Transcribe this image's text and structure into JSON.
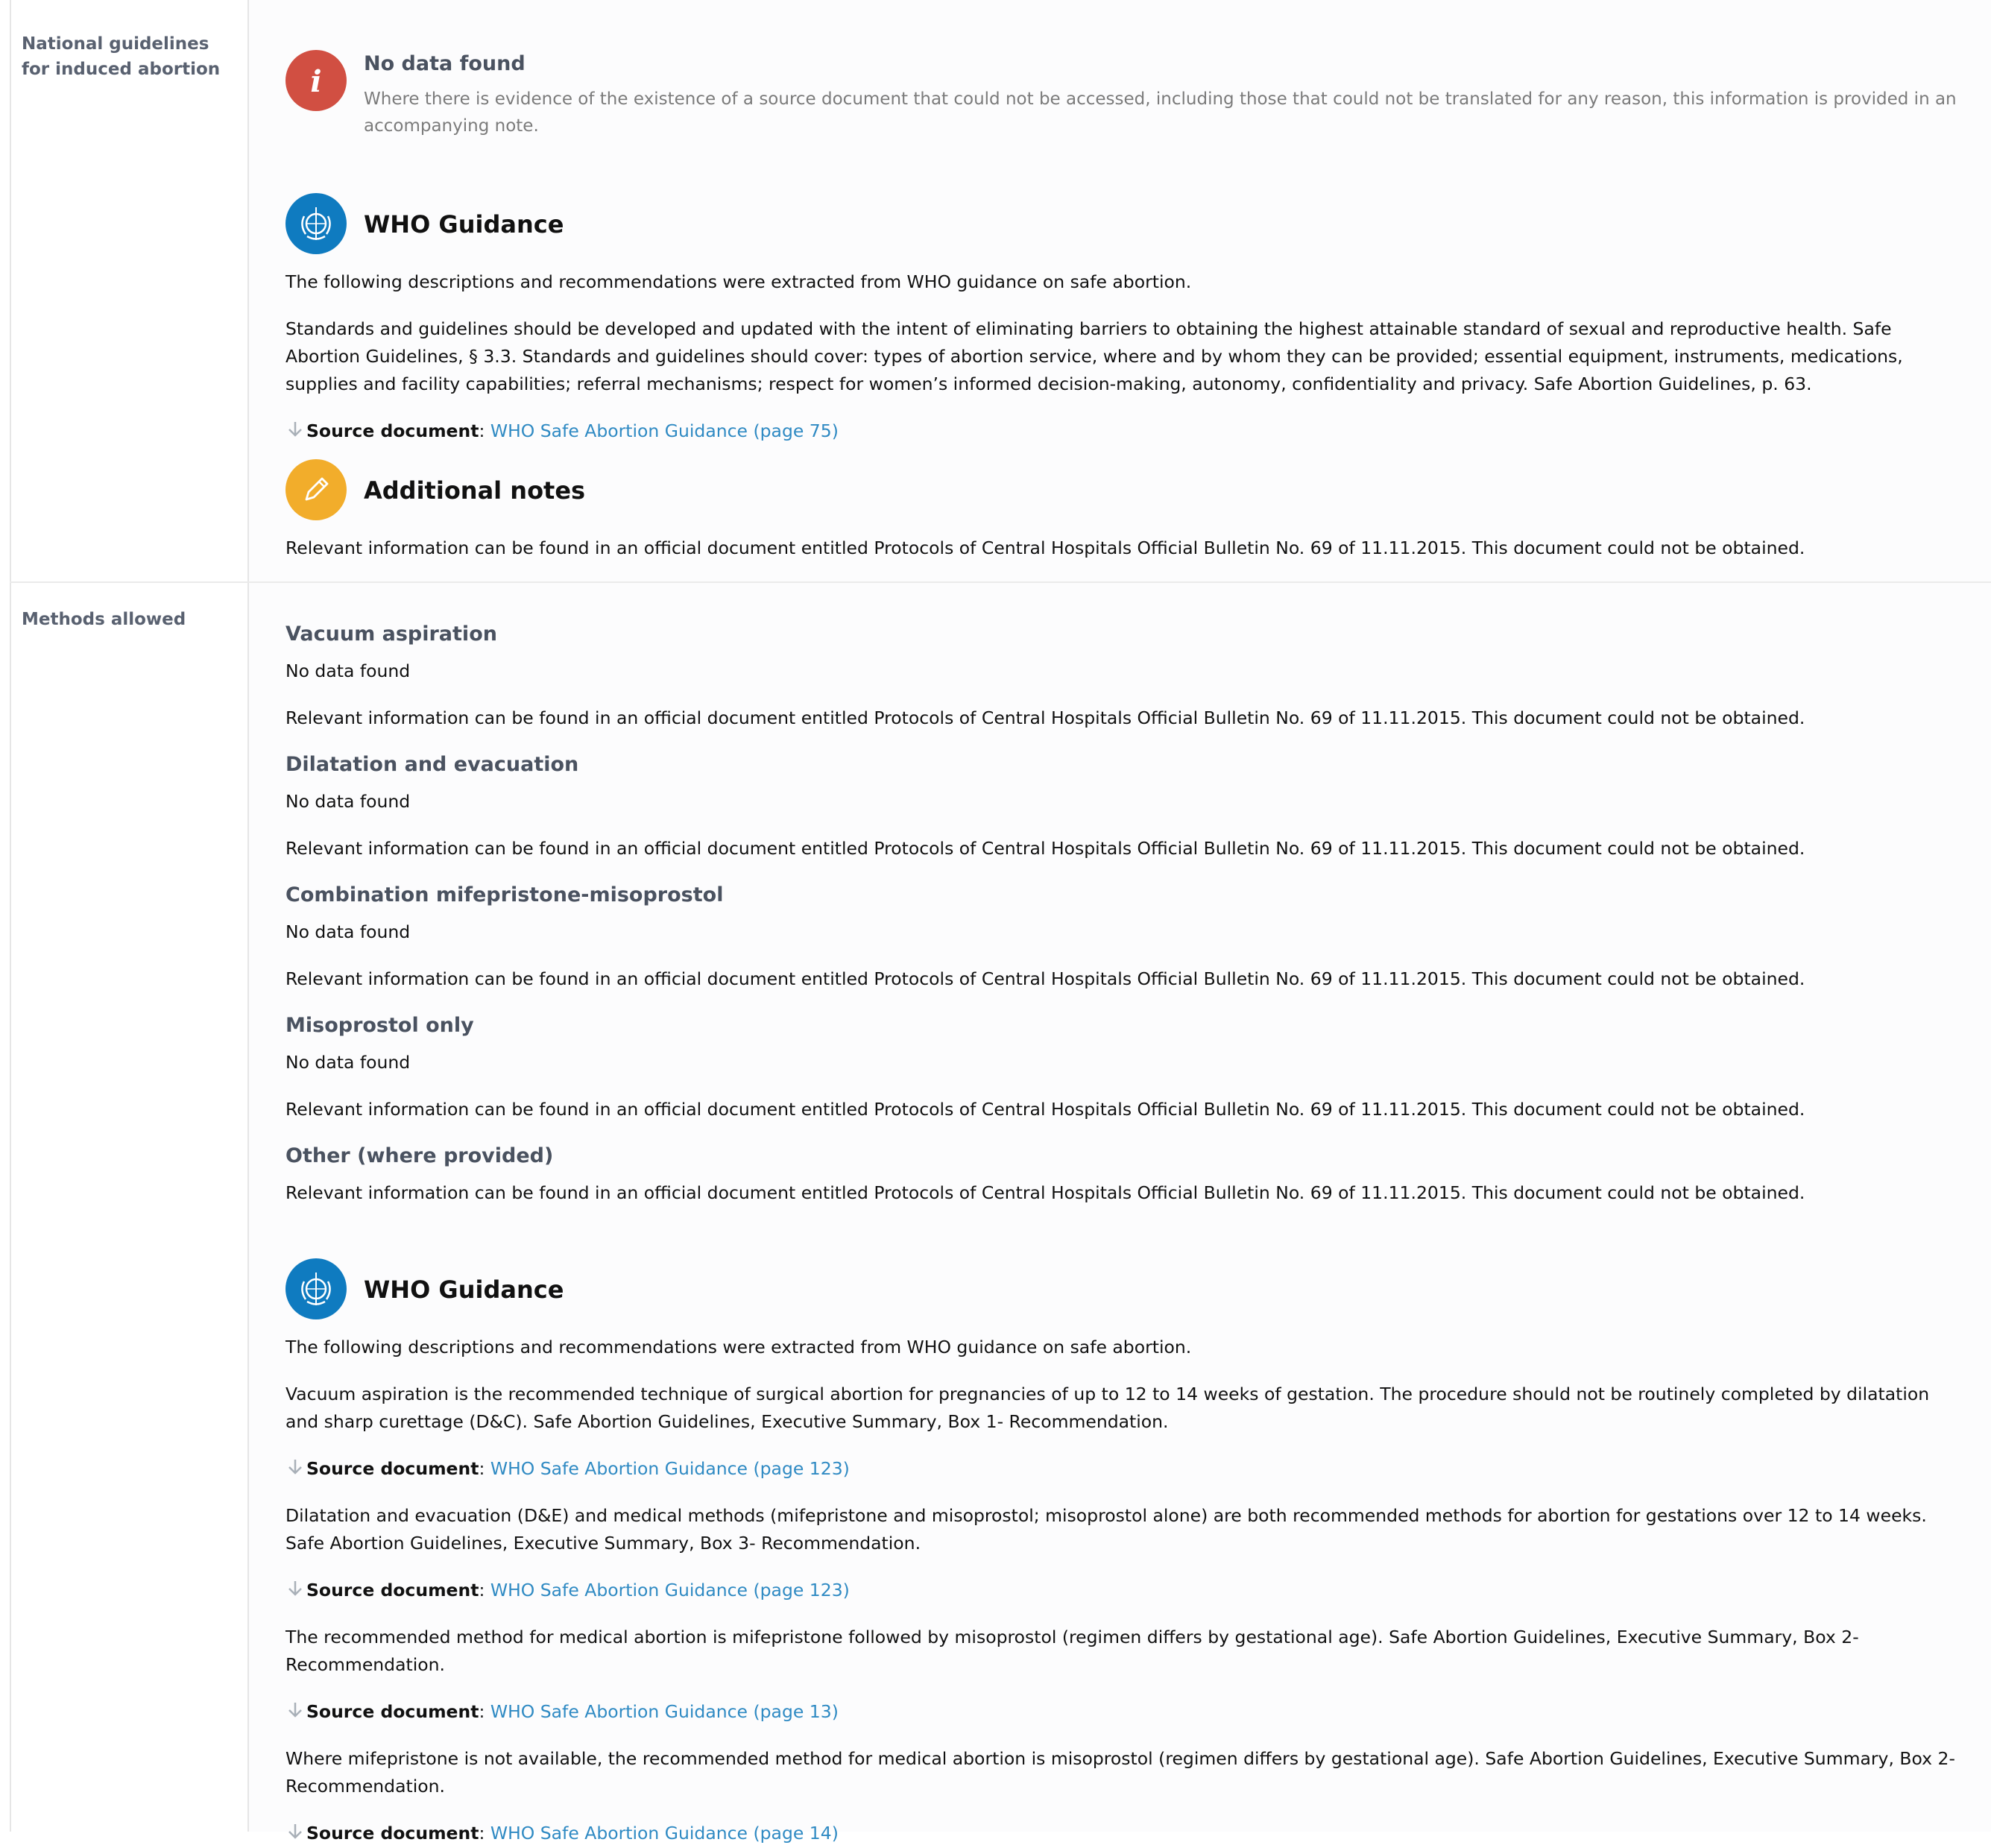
{
  "rows": {
    "guidelines": {
      "label": "National guidelines for induced abortion",
      "nodata_title": "No data found",
      "nodata_text": "Where there is evidence of the existence of a source document that could not be accessed, including those that could not be translated for any reason, this information is provided in an accompanying note.",
      "who_title": "WHO Guidance",
      "who_intro": "The following descriptions and recommendations were extracted from WHO guidance on safe abortion.",
      "who_para": "Standards and guidelines should be developed and updated with the intent of eliminating barriers to obtaining the highest attainable standard of sexual and reproductive health. Safe Abortion Guidelines, § 3.3. Standards and guidelines should cover: types of abortion service, where and by whom they can be provided; essential equipment, instruments, medications, supplies and facility capabilities; referral mechanisms; respect for women’s informed decision-making, autonomy, confidentiality and privacy. Safe Abortion Guidelines, p. 63.",
      "source_label": "Source document",
      "source_link": "WHO Safe Abortion Guidance (page 75)",
      "notes_title": "Additional notes",
      "notes_text": "Relevant information can be found in an official document entitled Protocols of Central Hospitals Official Bulletin No. 69 of 11.11.2015. This document could not be obtained."
    },
    "methods": {
      "label": "Methods allowed",
      "items": [
        {
          "title": "Vacuum aspiration",
          "nodata": "No data found",
          "note": "Relevant information can be found in an official document entitled Protocols of Central Hospitals Official Bulletin No. 69 of 11.11.2015. This document could not be obtained."
        },
        {
          "title": "Dilatation and evacuation",
          "nodata": "No data found",
          "note": "Relevant information can be found in an official document entitled Protocols of Central Hospitals Official Bulletin No. 69 of 11.11.2015. This document could not be obtained."
        },
        {
          "title": "Combination mifepristone-misoprostol",
          "nodata": "No data found",
          "note": "Relevant information can be found in an official document entitled Protocols of Central Hospitals Official Bulletin No. 69 of 11.11.2015. This document could not be obtained."
        },
        {
          "title": "Misoprostol only",
          "nodata": "No data found",
          "note": "Relevant information can be found in an official document entitled Protocols of Central Hospitals Official Bulletin No. 69 of 11.11.2015. This document could not be obtained."
        },
        {
          "title": "Other (where provided)",
          "note": "Relevant information can be found in an official document entitled Protocols of Central Hospitals Official Bulletin No. 69 of 11.11.2015. This document could not be obtained."
        }
      ],
      "who_title": "WHO Guidance",
      "who_intro": "The following descriptions and recommendations were extracted from WHO guidance on safe abortion.",
      "who_paras": [
        {
          "text": "Vacuum aspiration is the recommended technique of surgical abortion for pregnancies of up to 12 to 14 weeks of gestation. The procedure should not be routinely completed by dilatation and sharp curettage (D&C). Safe Abortion Guidelines, Executive Summary, Box 1- Recommendation.",
          "source_label": "Source document",
          "source_link": "WHO Safe Abortion Guidance (page 123)"
        },
        {
          "text": "Dilatation and evacuation (D&E) and medical methods (mifepristone and misoprostol; misoprostol alone) are both recommended methods for abortion for gestations over 12 to 14 weeks. Safe Abortion Guidelines, Executive Summary, Box 3- Recommendation.",
          "source_label": "Source document",
          "source_link": "WHO Safe Abortion Guidance (page 123)"
        },
        {
          "text": "The recommended method for medical abortion is mifepristone followed by misoprostol (regimen differs by gestational age). Safe Abortion Guidelines, Executive Summary, Box 2- Recommendation.",
          "source_label": "Source document",
          "source_link": "WHO Safe Abortion Guidance (page 13)"
        },
        {
          "text": "Where mifepristone is not available, the recommended method for medical abortion is misoprostol (regimen differs by gestational age). Safe Abortion Guidelines, Executive Summary, Box 2- Recommendation.",
          "source_label": "Source document",
          "source_link": "WHO Safe Abortion Guidance (page 14)"
        }
      ]
    }
  },
  "colors": {
    "accent_link": "#2f8ac3",
    "info_red": "#d14f42",
    "who_blue": "#0f7bc0",
    "notes_amber": "#f2ad2b"
  },
  "icons": [
    "info-icon",
    "who-emblem-icon",
    "pencil-icon",
    "arrow-down-icon"
  ]
}
